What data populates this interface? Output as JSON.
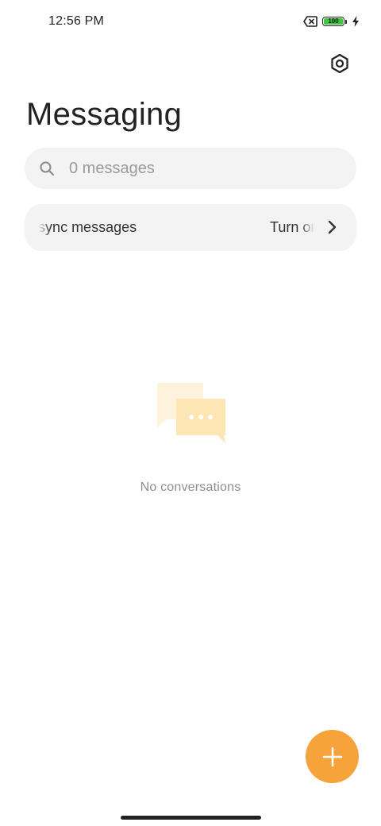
{
  "status_bar": {
    "time": "12:56 PM",
    "battery_level": "100",
    "icons": [
      "no-sim-icon",
      "battery-icon",
      "charging-bolt-icon"
    ],
    "battery_color": "#3ec83e"
  },
  "header": {
    "title": "Messaging",
    "settings_icon": "settings-hexagon-icon"
  },
  "search": {
    "placeholder": "0 messages",
    "value": "",
    "icon": "search-icon"
  },
  "sync_banner": {
    "text": "Use cloud to sync messages",
    "action": "Turn on",
    "icon": "chevron-right-icon"
  },
  "empty_state": {
    "text": "No conversations",
    "icon": "chat-bubbles-icon",
    "colors": {
      "back_bubble": "#fdf2dc",
      "front_bubble": "#fde5b4"
    }
  },
  "fab": {
    "icon": "plus-icon",
    "color": "#f5a33a"
  },
  "colors": {
    "accent": "#f5a33a",
    "surface": "#f3f3f3",
    "text_primary": "#222222",
    "text_secondary": "#8e8e8e"
  }
}
